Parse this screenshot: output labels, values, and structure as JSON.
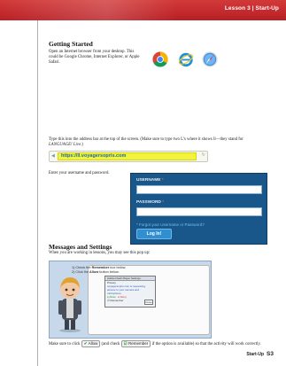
{
  "header": {
    "lesson_label": "Lesson 3 | Start-Up",
    "banner_color": "#c42a2e"
  },
  "getting_started": {
    "heading": "Getting Started",
    "intro": "Open an Internet browser from your desktop. This could be Google Chrome, Internet Explorer, or Apple Safari.",
    "browsers": [
      {
        "icon": "chrome-icon"
      },
      {
        "icon": "internet-explorer-icon"
      },
      {
        "icon": "safari-icon"
      }
    ],
    "instruction_pre": "Type this into the address bar at the top of the screen. (Make sure to type two L’s where it shows ll—they stand for ",
    "instruction_em": "LANGUAGE! Live",
    "instruction_post": ".)",
    "url": "https://ll.voyagersopris.com"
  },
  "login_instruction": "Enter your username and password.",
  "login": {
    "username_label": "USERNAME",
    "password_label": "PASSWORD",
    "required_mark": "*",
    "forgot_link": "* Forgot your Username or Password?",
    "login_button": "Log In!"
  },
  "messages": {
    "heading": "Messages and Settings",
    "intro": "When you are working in lessons, you may see this pop up:",
    "popup": {
      "step1_pre": "1) Check the ",
      "step1_bold": "Remember",
      "step1_post": " box below.",
      "step2_pre": "2) Click the ",
      "step2_bold": "Allow",
      "step2_post": " button below.",
      "dialog_title": "Adobe Flash Player Settings",
      "dialog_line1": "Privacy",
      "dialog_line2": "voyagersopris.com is requesting access to your camera and microphone.",
      "allow": "Allow",
      "deny": "Deny",
      "remember": "Remember",
      "close": "Close"
    },
    "note_pre": "Make sure to click",
    "allow_chip": "Allow",
    "note_mid": "(and check",
    "remember_chip": "Remember",
    "note_post": "if the option is available) so that the activity will work correctly."
  },
  "footer": {
    "section": "Start-Up",
    "page": "S3"
  }
}
